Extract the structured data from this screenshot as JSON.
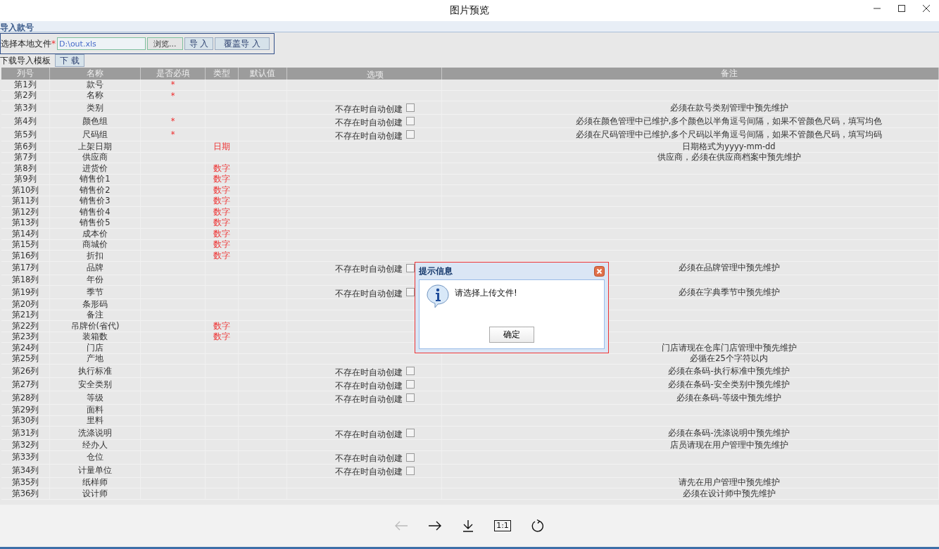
{
  "window": {
    "title": "图片预览"
  },
  "page": {
    "section_title": "导入款号",
    "file_row": {
      "label": "选择本地文件",
      "required_mark": "*",
      "value": "D:\\out.xls",
      "browse": "浏览...",
      "import": "导 入",
      "overwrite_import": "覆盖导 入"
    },
    "template_row": {
      "label": "下载导入模板",
      "download": "下 载"
    },
    "table": {
      "columns": [
        "列号",
        "名称",
        "是否必填",
        "类型",
        "默认值",
        "选项",
        "备注"
      ],
      "rows": [
        {
          "col": "第1列",
          "name": "款号",
          "required_mark": "*"
        },
        {
          "col": "第2列",
          "name": "名称",
          "required_mark": "*"
        },
        {
          "col": "第3列",
          "name": "类别",
          "option": {
            "label": "不存在时自动创建",
            "checked": false
          },
          "remark": "必须在款号类别管理中预先维护"
        },
        {
          "col": "第4列",
          "name": "颜色组",
          "required_mark": "*",
          "option": {
            "label": "不存在时自动创建",
            "checked": false
          },
          "remark": "必须在颜色管理中已维护,多个颜色以半角逗号间隔，如果不管颜色尺码，填写均色"
        },
        {
          "col": "第5列",
          "name": "尺码组",
          "required_mark": "*",
          "option": {
            "label": "不存在时自动创建",
            "checked": false
          },
          "remark": "必须在尺码管理中已维护,多个尺码以半角逗号间隔，如果不管颜色尺码，填写均码"
        },
        {
          "col": "第6列",
          "name": "上架日期",
          "type": "日期",
          "remark": "日期格式为yyyy-mm-dd"
        },
        {
          "col": "第7列",
          "name": "供应商",
          "remark": "供应商，必须在供应商档案中预先维护"
        },
        {
          "col": "第8列",
          "name": "进货价",
          "type": "数字"
        },
        {
          "col": "第9列",
          "name": "销售价1",
          "type": "数字"
        },
        {
          "col": "第10列",
          "name": "销售价2",
          "type": "数字"
        },
        {
          "col": "第11列",
          "name": "销售价3",
          "type": "数字"
        },
        {
          "col": "第12列",
          "name": "销售价4",
          "type": "数字"
        },
        {
          "col": "第13列",
          "name": "销售价5",
          "type": "数字"
        },
        {
          "col": "第14列",
          "name": "成本价",
          "type": "数字"
        },
        {
          "col": "第15列",
          "name": "商城价",
          "type": "数字"
        },
        {
          "col": "第16列",
          "name": "折扣",
          "type": "数字"
        },
        {
          "col": "第17列",
          "name": "品牌",
          "option": {
            "label": "不存在时自动创建",
            "checked": false
          },
          "remark": "必须在品牌管理中预先维护"
        },
        {
          "col": "第18列",
          "name": "年份"
        },
        {
          "col": "第19列",
          "name": "季节",
          "option": {
            "label": "不存在时自动创建",
            "checked": false
          },
          "remark": "必须在字典季节中预先维护"
        },
        {
          "col": "第20列",
          "name": "条形码"
        },
        {
          "col": "第21列",
          "name": "备注"
        },
        {
          "col": "第22列",
          "name": "吊牌价(省代)",
          "type": "数字"
        },
        {
          "col": "第23列",
          "name": "装箱数",
          "type": "数字"
        },
        {
          "col": "第24列",
          "name": "门店",
          "remark": "门店请现在仓库门店管理中预先维护"
        },
        {
          "col": "第25列",
          "name": "产地",
          "remark": "必循在25个字符以内"
        },
        {
          "col": "第26列",
          "name": "执行标准",
          "option": {
            "label": "不存在时自动创建",
            "checked": false
          },
          "remark": "必须在条码-执行标准中预先维护"
        },
        {
          "col": "第27列",
          "name": "安全类别",
          "option": {
            "label": "不存在时自动创建",
            "checked": false
          },
          "remark": "必须在条码-安全类别中预先维护"
        },
        {
          "col": "第28列",
          "name": "等级",
          "option": {
            "label": "不存在时自动创建",
            "checked": false
          },
          "remark": "必须在条码-等级中预先维护"
        },
        {
          "col": "第29列",
          "name": "面料"
        },
        {
          "col": "第30列",
          "name": "里料"
        },
        {
          "col": "第31列",
          "name": "洗涤说明",
          "option": {
            "label": "不存在时自动创建",
            "checked": false
          },
          "remark": "必须在条码-洗涤说明中预先维护"
        },
        {
          "col": "第32列",
          "name": "经办人",
          "remark": "店员请现在用户管理中预先维护"
        },
        {
          "col": "第33列",
          "name": "仓位",
          "option": {
            "label": "不存在时自动创建",
            "checked": false
          }
        },
        {
          "col": "第34列",
          "name": "计量单位",
          "option": {
            "label": "不存在时自动创建",
            "checked": false
          }
        },
        {
          "col": "第35列",
          "name": "纸样师",
          "remark": "请先在用户管理中预先维护"
        },
        {
          "col": "第36列",
          "name": "设计师",
          "remark": "必须在设计师中预先维护"
        }
      ]
    }
  },
  "dialog": {
    "title": "提示信息",
    "message": "请选择上传文件!",
    "ok": "确定"
  },
  "toolbar": {
    "previous_disabled": true,
    "actual_size": "1:1"
  }
}
